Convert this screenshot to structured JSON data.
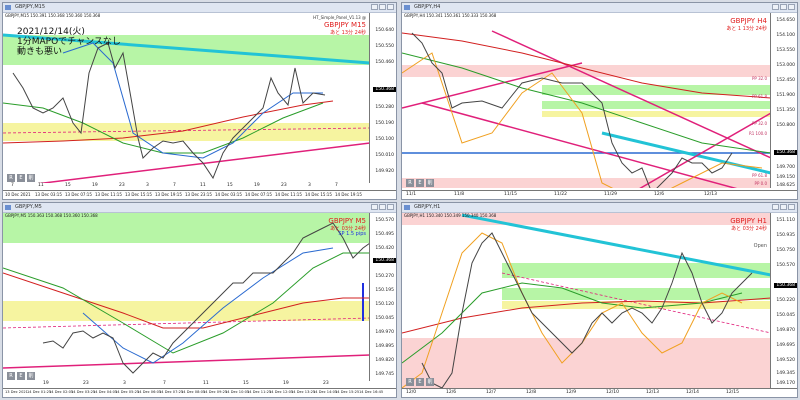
{
  "windows": [
    {
      "title": "GBPJPY,M15",
      "info": "GBPJPY,M15  150.391 150.368 150.360 150.368",
      "indicator": "HT_Simple_Panel_V1.13 @",
      "overlay_lines": [
        "2021/12/14(火)",
        "1分MAPOでチャンスなし",
        "動きも悪い"
      ],
      "symbol_label": "GBPJPY M15",
      "remaining": "あと 13分 24秒",
      "price_ticks": [
        "150.640",
        "150.550",
        "150.460",
        "150.368",
        "150.280",
        "150.190",
        "150.100",
        "150.010",
        "149.920",
        "149.830"
      ],
      "current_price": "150.368",
      "time_labels": [
        "10 Dec 2021",
        "13 Dec 03:15",
        "13 Dec 07:15",
        "13 Dec 11:15",
        "13 Dec 15:15",
        "13 Dec 19:15",
        "13 Dec 23:15",
        "14 Dec 03:15",
        "14 Dec 07:15",
        "14 Dec 11:15",
        "14 Dec 15:15",
        "14 Dec 19:15"
      ],
      "day_numbers": [
        "7",
        "11",
        "15",
        "19",
        "23",
        "3",
        "7",
        "11",
        "15",
        "19",
        "23",
        "3",
        "7"
      ],
      "buttons": [
        "R",
        "E",
        "削"
      ]
    },
    {
      "title": "GBPJPY,H4",
      "info": "GBPJPY,H4  150.341 150.361 150.333 150.368",
      "symbol_label": "GBPJPY H4",
      "remaining": "あと 1 13分 24秒",
      "price_ticks": [
        "154.650",
        "154.100",
        "153.550",
        "153.000",
        "152.450",
        "151.900",
        "151.350",
        "150.800",
        "150.368",
        "149.700",
        "149.150",
        "148.625"
      ],
      "current_price": "150.368",
      "time_labels": [
        "11/1",
        "11/8",
        "11/15",
        "11/22",
        "11/29",
        "12/6",
        "12/13"
      ],
      "level_labels": [
        "PP 32.0",
        "PP 61.8",
        "PP 32.0",
        "R1 100.0",
        "PP 61.8",
        "PP 0.0"
      ],
      "buttons": [
        "R",
        "E",
        "削"
      ]
    },
    {
      "title": "GBPJPY,M5",
      "info": "GBPJPY,M5  150.363 150.368 150.360 150.368",
      "symbol_label": "GBPJPY M5",
      "remaining": "あと 03分 24秒",
      "spread": "SP 1.5 pips",
      "price_ticks": [
        "150.570",
        "150.495",
        "150.420",
        "150.368",
        "150.270",
        "150.195",
        "150.120",
        "150.045",
        "149.970",
        "149.895",
        "149.820",
        "149.745"
      ],
      "current_price": "150.368",
      "time_labels": [
        "13 Dec 2021",
        "14 Dec 01:25",
        "14 Dec 02:05",
        "14 Dec 03:25",
        "14 Dec 04:05",
        "14 Dec 05:25",
        "14 Dec 06:05",
        "14 Dec 07:25",
        "14 Dec 08:05",
        "14 Dec 09:25",
        "14 Dec 10:05",
        "14 Dec 11:25",
        "14 Dec 12:05",
        "14 Dec 13:25",
        "14 Dec 14:05",
        "14 Dec 15:25",
        "14 Dec 16:45"
      ],
      "day_numbers": [
        "19",
        "23",
        "3",
        "7",
        "11",
        "15",
        "19",
        "23"
      ],
      "buttons": [
        "R",
        "E",
        "削"
      ]
    },
    {
      "title": "GBPJPY,H1",
      "info": "GBPJPY,H1  150.340 150.349 150.340 150.368",
      "symbol_label": "GBPJPY H1",
      "remaining": "あと 03分 24秒",
      "open_label": "Open",
      "price_ticks": [
        "151.110",
        "150.935",
        "150.750",
        "150.570",
        "150.368",
        "150.220",
        "150.045",
        "149.870",
        "149.695",
        "149.520",
        "149.345",
        "149.170"
      ],
      "current_price": "150.368",
      "time_labels": [
        "12/0",
        "12/6",
        "12/7",
        "12/8",
        "12/9",
        "12/10",
        "12/13",
        "12/14",
        "12/15"
      ],
      "buttons": [
        "R",
        "E",
        "削"
      ]
    }
  ],
  "colors": {
    "green_zone": "#b7f5a6",
    "yellow_zone": "#f6f4a0",
    "red_zone": "#fbd3d3",
    "trend_cyan": "#22c3d6",
    "trend_magenta": "#e0207a",
    "ma_red": "#d22020",
    "ma_green": "#2a9d2a",
    "ma_blue": "#2a6ad0",
    "band_orange": "#f0a020",
    "label_red": "#e02020"
  }
}
